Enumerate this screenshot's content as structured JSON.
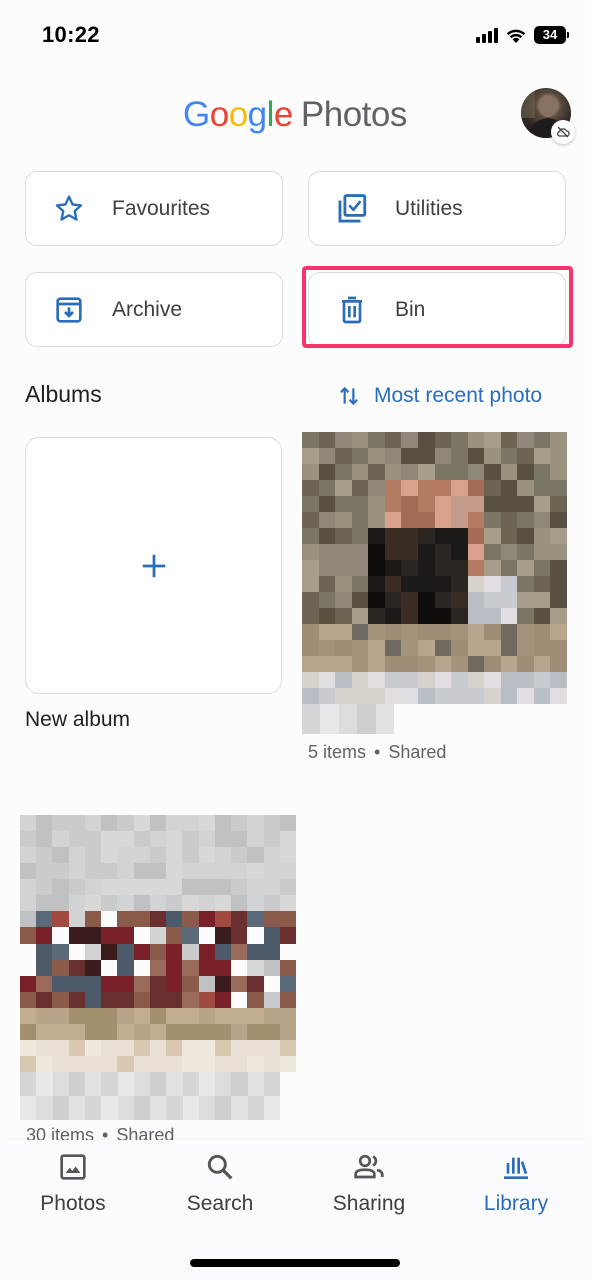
{
  "status_bar": {
    "time": "10:22",
    "battery": "34"
  },
  "header": {
    "logo_google": [
      "G",
      "o",
      "o",
      "g",
      "l",
      "e"
    ],
    "logo_product": "Photos"
  },
  "utilities": [
    {
      "label": "Favourites",
      "icon": "star-icon"
    },
    {
      "label": "Utilities",
      "icon": "utilities-checklist-icon"
    },
    {
      "label": "Archive",
      "icon": "archive-icon"
    },
    {
      "label": "Bin",
      "icon": "trash-icon",
      "highlighted": true
    }
  ],
  "albums": {
    "title": "Albums",
    "sort_label": "Most recent photo",
    "new_album_label": "New album",
    "items": [
      {
        "meta_count": "5 items",
        "meta_status": "Shared"
      },
      {
        "meta_count": "30 items",
        "meta_status": "Shared"
      }
    ]
  },
  "nav": [
    {
      "label": "Photos",
      "icon": "photo-icon",
      "active": false
    },
    {
      "label": "Search",
      "icon": "search-icon",
      "active": false
    },
    {
      "label": "Sharing",
      "icon": "people-icon",
      "active": false
    },
    {
      "label": "Library",
      "icon": "library-icon",
      "active": true
    }
  ],
  "colors": {
    "accent": "#2a6ebb",
    "highlight": "#f7336b",
    "border": "#dadce0"
  }
}
